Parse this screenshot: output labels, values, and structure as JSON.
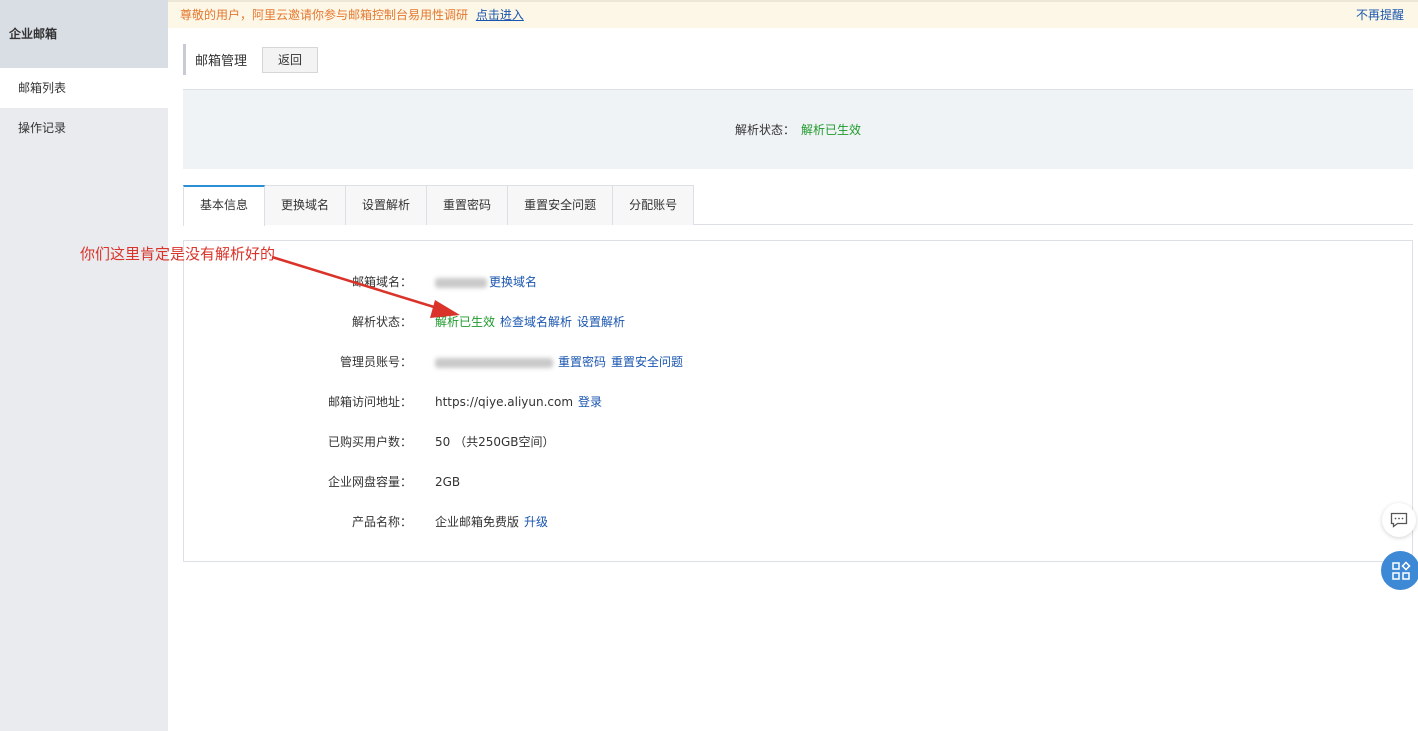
{
  "sidebar": {
    "title": "企业邮箱",
    "items": [
      {
        "label": "邮箱列表"
      },
      {
        "label": "操作记录"
      }
    ]
  },
  "notice": {
    "text": "尊敬的用户，阿里云邀请你参与邮箱控制台易用性调研",
    "link": "点击进入",
    "dismiss": "不再提醒"
  },
  "header": {
    "title": "邮箱管理",
    "back_label": "返回"
  },
  "status_banner": {
    "label": "解析状态：",
    "value": "解析已生效"
  },
  "tabs": [
    {
      "label": "基本信息"
    },
    {
      "label": "更换域名"
    },
    {
      "label": "设置解析"
    },
    {
      "label": "重置密码"
    },
    {
      "label": "重置安全问题"
    },
    {
      "label": "分配账号"
    }
  ],
  "info": {
    "domain": {
      "label": "邮箱域名：",
      "link": "更换域名"
    },
    "resolve": {
      "label": "解析状态：",
      "status": "解析已生效",
      "link1": "检查域名解析",
      "link2": "设置解析"
    },
    "admin": {
      "label": "管理员账号：",
      "link1": "重置密码",
      "link2": "重置安全问题"
    },
    "url": {
      "label": "邮箱访问地址：",
      "value": "https://qiye.aliyun.com",
      "link": "登录"
    },
    "users": {
      "label": "已购买用户数：",
      "value": "50 （共250GB空间）"
    },
    "disk": {
      "label": "企业网盘容量：",
      "value": "2GB"
    },
    "product": {
      "label": "产品名称：",
      "value": "企业邮箱免费版",
      "link": "升级"
    }
  },
  "annotation": {
    "text": "你们这里肯定是没有解析好的",
    "color": "#d9332a"
  },
  "colors": {
    "accent": "#2a8fd6",
    "link": "#1a56b0",
    "success": "#1f9b2c",
    "notice_text": "#e4782f"
  }
}
